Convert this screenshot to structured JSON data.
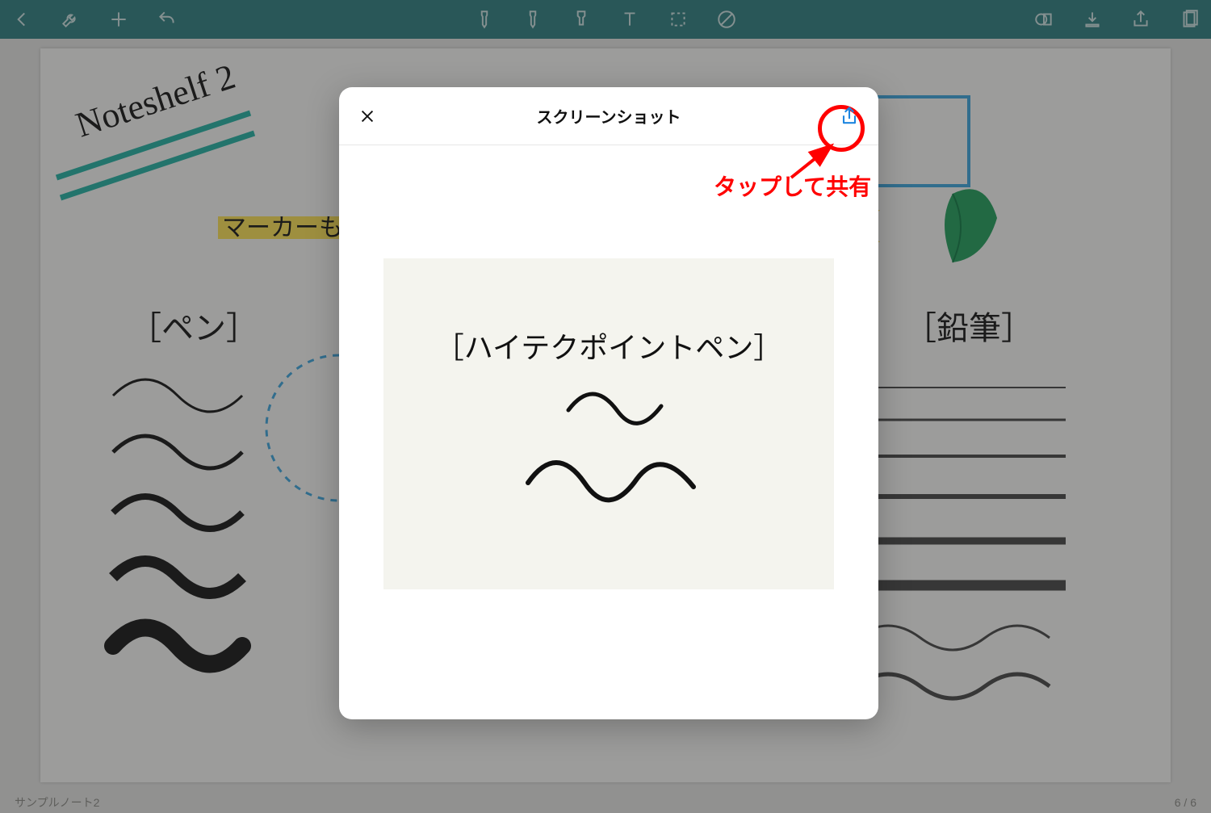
{
  "app": {
    "title": "Noteshelf 2"
  },
  "modal": {
    "title": "スクリーンショット",
    "preview_label": "［ハイテクポイントペン］"
  },
  "annotation": {
    "tap_to_share": "タップして共有"
  },
  "canvas": {
    "title_script": "Noteshelf 2",
    "highlighter_label": "マーカーも",
    "pen_label": "［ペン］",
    "pencil_label": "［鉛筆］"
  },
  "footer": {
    "notebook_name": "サンプルノート2",
    "page_indicator": "6 / 6"
  },
  "icons": {
    "back": "back-icon",
    "wrench": "wrench-icon",
    "plus": "plus-icon",
    "undo": "undo-icon",
    "pen": "pen-tool-icon",
    "pen2": "pen2-tool-icon",
    "highlighter": "highlighter-tool-icon",
    "eraser": "eraser-tool-icon",
    "text": "text-tool-icon",
    "select": "select-tool-icon",
    "no_circle": "no-tool-icon",
    "shape": "shape-icon",
    "download": "download-icon",
    "share": "share-icon",
    "pages": "pages-icon",
    "close": "close-icon",
    "modal_share": "share-icon"
  }
}
